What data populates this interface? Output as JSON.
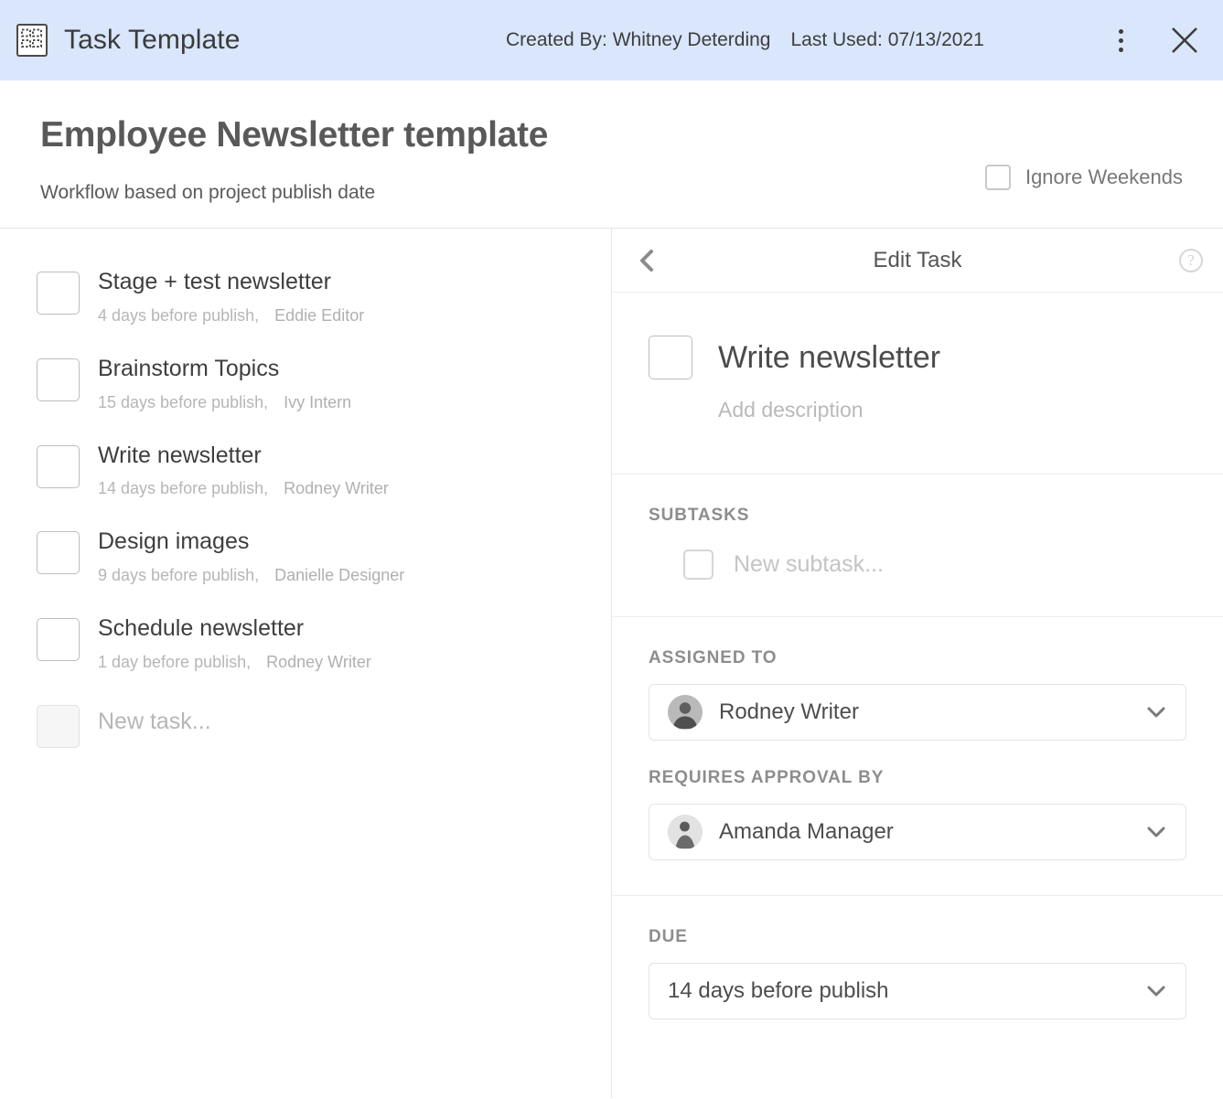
{
  "titlebar": {
    "icon": "template-grid-icon",
    "title": "Task Template",
    "created_by": "Created By: Whitney Deterding",
    "last_used": "Last Used: 07/13/2021",
    "menu_icon": "kebab-menu-icon",
    "close_icon": "close-icon",
    "bg_color": "#d9e6fb"
  },
  "page": {
    "title": "Employee Newsletter template",
    "subtitle": "Workflow based on project publish date",
    "ignore_weekends": {
      "label": "Ignore Weekends",
      "checked": false
    }
  },
  "tasks": [
    {
      "title": "Stage + test newsletter",
      "due": "4 days before publish,",
      "assignee": "Eddie Editor",
      "checked": false
    },
    {
      "title": "Brainstorm Topics",
      "due": "15 days before publish,",
      "assignee": "Ivy Intern",
      "checked": false
    },
    {
      "title": "Write newsletter",
      "due": "14 days before publish,",
      "assignee": "Rodney Writer",
      "checked": false
    },
    {
      "title": "Design images",
      "due": "9 days before publish,",
      "assignee": "Danielle Designer",
      "checked": false
    },
    {
      "title": "Schedule newsletter",
      "due": "1 day before publish,",
      "assignee": "Rodney Writer",
      "checked": false
    }
  ],
  "new_task": {
    "placeholder": "New task..."
  },
  "edit_panel": {
    "back_icon": "chevron-left-icon",
    "title": "Edit Task",
    "help_icon": "help-circle-icon",
    "task": {
      "title": "Write newsletter",
      "checked": false,
      "description_placeholder": "Add description"
    },
    "subtasks": {
      "label": "SUBTASKS",
      "new_placeholder": "New subtask...",
      "items": []
    },
    "assigned_to": {
      "label": "ASSIGNED TO",
      "value": "Rodney Writer",
      "avatar": "user-avatar"
    },
    "requires_approval_by": {
      "label": "REQUIRES APPROVAL BY",
      "value": "Amanda Manager",
      "avatar": "user-avatar"
    },
    "due": {
      "label": "DUE",
      "value": "14 days before publish"
    }
  }
}
